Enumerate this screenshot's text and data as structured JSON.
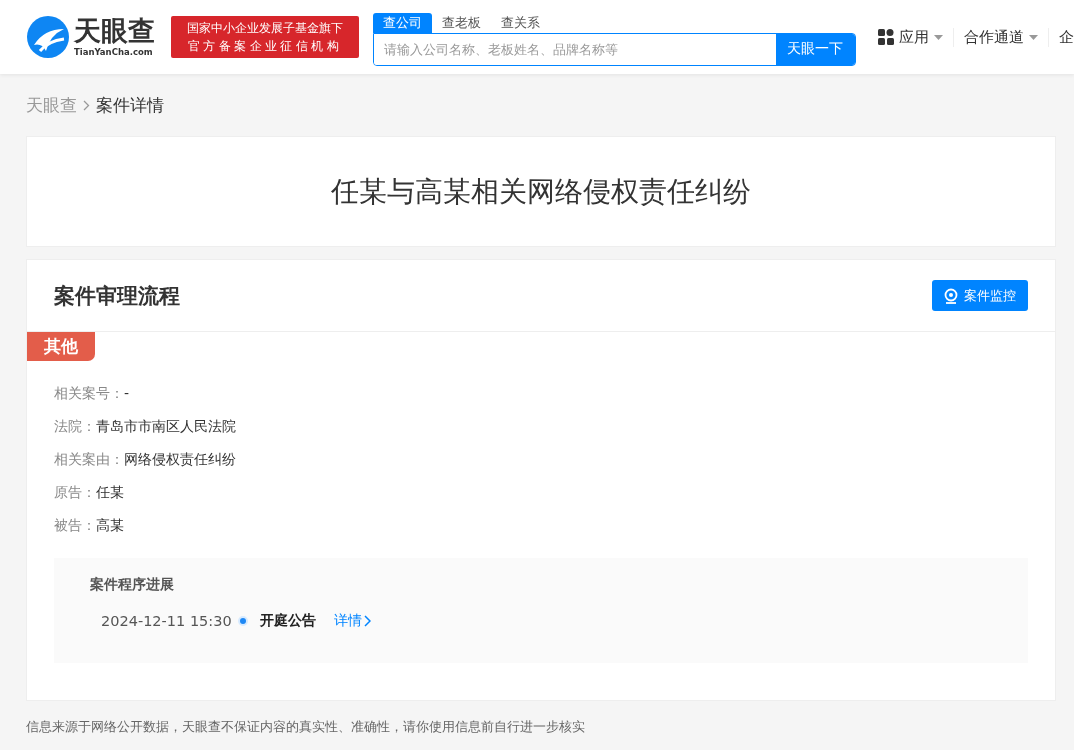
{
  "header": {
    "logo": {
      "name": "天眼查",
      "domain": "TianYanCha.com"
    },
    "badge": [
      "国家中小企业发展子基金旗下",
      "官方备案企业征信机构"
    ],
    "search_tabs": [
      {
        "label": "查公司",
        "selected": true
      },
      {
        "label": "查老板",
        "selected": false
      },
      {
        "label": "查关系",
        "selected": false
      }
    ],
    "search": {
      "placeholder": "请输入公司名称、老板姓名、品牌名称等",
      "button": "天眼一下"
    },
    "nav": [
      {
        "label": "应用",
        "kind": "apps"
      },
      {
        "label": "合作通道",
        "kind": "dropdown"
      },
      {
        "label": "企",
        "kind": "plain"
      }
    ]
  },
  "breadcrumb": [
    {
      "label": "天眼查",
      "current": false
    },
    {
      "label": "案件详情",
      "current": true
    }
  ],
  "case_title": "任某与高某相关网络侵权责任纠纷",
  "process": {
    "title": "案件审理流程",
    "monitor_button": "案件监控",
    "tag": "其他",
    "fields": [
      {
        "label": "相关案号：",
        "value": "-"
      },
      {
        "label": "法院：",
        "value": "青岛市市南区人民法院"
      },
      {
        "label": "相关案由：",
        "value": "网络侵权责任纠纷"
      },
      {
        "label": "原告：",
        "value": "任某"
      },
      {
        "label": "被告：",
        "value": "高某"
      }
    ],
    "progress": {
      "title": "案件程序进展",
      "events": [
        {
          "time": "2024-12-11 15:30",
          "name": "开庭公告",
          "link": "详情"
        }
      ]
    }
  },
  "footer": "信息来源于网络公开数据，天眼查不保证内容的真实性、准确性，请你使用信息前自行进一步核实"
}
